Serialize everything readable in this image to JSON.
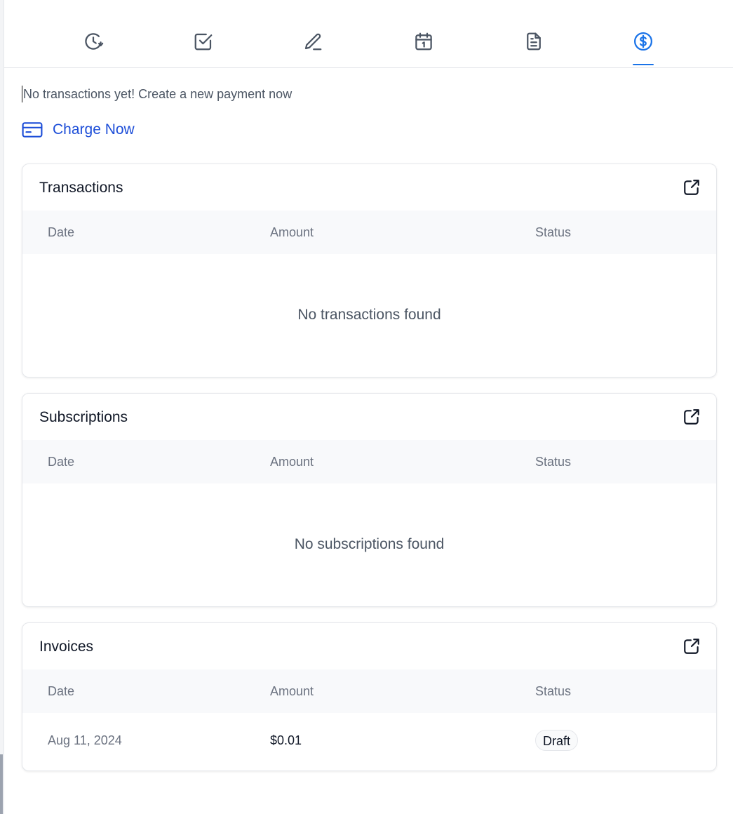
{
  "tabs": [
    {
      "name": "activity",
      "icon": "clock-refresh-icon",
      "active": false
    },
    {
      "name": "tasks",
      "icon": "checkbox-icon",
      "active": false
    },
    {
      "name": "notes",
      "icon": "pen-icon",
      "active": false
    },
    {
      "name": "appointments",
      "icon": "calendar-icon",
      "active": false
    },
    {
      "name": "documents",
      "icon": "document-icon",
      "active": false
    },
    {
      "name": "payments",
      "icon": "dollar-circle-icon",
      "active": true
    }
  ],
  "colors": {
    "accent": "#1a73e8",
    "link": "#1d4ed8",
    "muted": "#6b7280"
  },
  "empty_note": "No transactions yet! Create a new payment now",
  "charge_label": "Charge Now",
  "transactions": {
    "title": "Transactions",
    "columns": [
      "Date",
      "Amount",
      "Status"
    ],
    "empty": "No transactions found"
  },
  "subscriptions": {
    "title": "Subscriptions",
    "columns": [
      "Date",
      "Amount",
      "Status"
    ],
    "empty": "No subscriptions found"
  },
  "invoices": {
    "title": "Invoices",
    "columns": [
      "Date",
      "Amount",
      "Status"
    ],
    "rows": [
      {
        "date": "Aug 11, 2024",
        "amount": "$0.01",
        "status": "Draft"
      }
    ]
  }
}
